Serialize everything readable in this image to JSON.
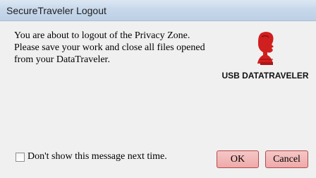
{
  "window": {
    "title": "SecureTraveler Logout"
  },
  "message": {
    "lines": [
      "You are about to logout of the Privacy Zone.",
      "Please save your work and close all files opened",
      "from your DataTraveler."
    ]
  },
  "logo": {
    "text": "USB DATATRAVELER",
    "icon": "kingston-head-logo-icon",
    "color": "#d01f1f"
  },
  "footer": {
    "checkbox_label": "Don't show this message next time.",
    "checkbox_checked": false,
    "ok_label": "OK",
    "cancel_label": "Cancel"
  },
  "colors": {
    "button_fill": "#eeaaaa",
    "button_border": "#b24a4a",
    "titlebar": "#c6d7ea"
  }
}
